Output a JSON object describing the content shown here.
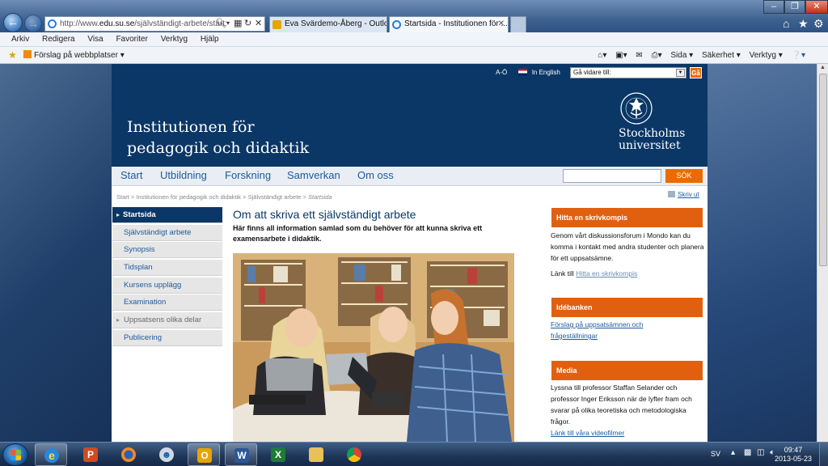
{
  "browser": {
    "address": {
      "prefix": "http://www.",
      "domain": "edu.su.se",
      "path": "/självständigt-arbete/start:"
    },
    "tabs": [
      {
        "label": "Eva Svärdemo-Åberg - Outloo..."
      },
      {
        "label": "Startsida - Institutionen för ..."
      }
    ],
    "menu": [
      "Arkiv",
      "Redigera",
      "Visa",
      "Favoriter",
      "Verktyg",
      "Hjälp"
    ],
    "favorites_suggest": "Förslag på webbplatser ▾",
    "command_bar": [
      "Sida ▾",
      "Säkerhet ▾",
      "Verktyg ▾"
    ]
  },
  "header": {
    "az": "A-Ö",
    "english": "In English",
    "goto_placeholder": "Gå vidare till:",
    "goto_button": "Gå",
    "site_title": "Institutionen för pedagogik och didaktik",
    "logo_line1": "Stockholms",
    "logo_line2": "universitet"
  },
  "topnav": [
    "Start",
    "Utbildning",
    "Forskning",
    "Samverkan",
    "Om oss"
  ],
  "search_button": "SÖK",
  "breadcrumb": {
    "path": "Start > Institutionen för pedagogik och didaktik > Självständigt arbete > ",
    "current": "Startsida"
  },
  "print_link": "Skriv ut",
  "leftnav": [
    {
      "label": "Startsida"
    },
    {
      "label": "Självständigt arbete"
    },
    {
      "label": "Synopsis"
    },
    {
      "label": "Tidsplan"
    },
    {
      "label": "Kursens upplägg"
    },
    {
      "label": "Examination"
    },
    {
      "label": "Uppsatsens olika delar"
    },
    {
      "label": "Publicering"
    }
  ],
  "main": {
    "title": "Om att skriva ett självständigt arbete",
    "lead": "Här finns all information samlad som du behöver för att kunna skriva ett examensarbete i didaktik."
  },
  "sidebar": {
    "box1": {
      "title": "Hitta en skrivkompis",
      "text": "Genom vårt diskussionsforum i Mondo kan du komma i kontakt med andra studenter och planera för ett uppsatsämne.",
      "link_label": "Länk till ",
      "link": "Hitta en skrivkompis"
    },
    "box2": {
      "title": "Idébanken",
      "link1": "Förslag på uppsatsämnen och",
      "link2": "frågeställningar"
    },
    "box3": {
      "title": "Media",
      "text": "Lyssna till professor Staffan Selander och professor Inger Eriksson när de lyfter fram och svarar på olika teoretiska och metodologiska frågor.",
      "link": "Länk till våra videofilmer"
    }
  },
  "taskbar": {
    "lang": "SV",
    "time": "09:47",
    "date": "2013-05-23"
  },
  "colors": {
    "su_blue": "#0a3766",
    "accent_orange": "#e06010",
    "link_blue": "#1c5a9c"
  }
}
